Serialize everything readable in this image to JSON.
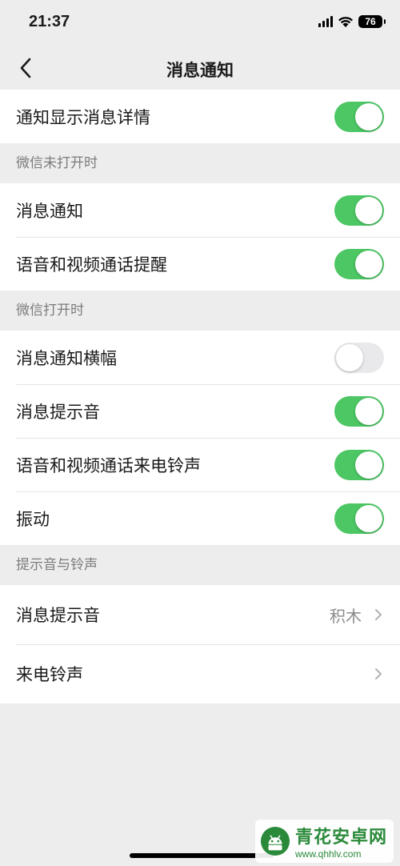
{
  "status": {
    "time": "21:37",
    "battery": "76"
  },
  "nav": {
    "title": "消息通知"
  },
  "top_group": {
    "items": [
      {
        "label": "通知显示消息详情",
        "on": true
      }
    ]
  },
  "section1": {
    "header": "微信未打开时",
    "items": [
      {
        "label": "消息通知",
        "on": true
      },
      {
        "label": "语音和视频通话提醒",
        "on": true
      }
    ]
  },
  "section2": {
    "header": "微信打开时",
    "items": [
      {
        "label": "消息通知横幅",
        "on": false
      },
      {
        "label": "消息提示音",
        "on": true
      },
      {
        "label": "语音和视频通话来电铃声",
        "on": true
      },
      {
        "label": "振动",
        "on": true
      }
    ]
  },
  "section3": {
    "header": "提示音与铃声",
    "items": [
      {
        "label": "消息提示音",
        "value": "积木"
      },
      {
        "label": "来电铃声",
        "value": ""
      }
    ]
  },
  "watermark": {
    "title": "青花安卓网",
    "url": "www.qhhlv.com"
  },
  "colors": {
    "toggle_on": "#4cc764",
    "toggle_off": "#e9e9eb",
    "background": "#ededed"
  }
}
